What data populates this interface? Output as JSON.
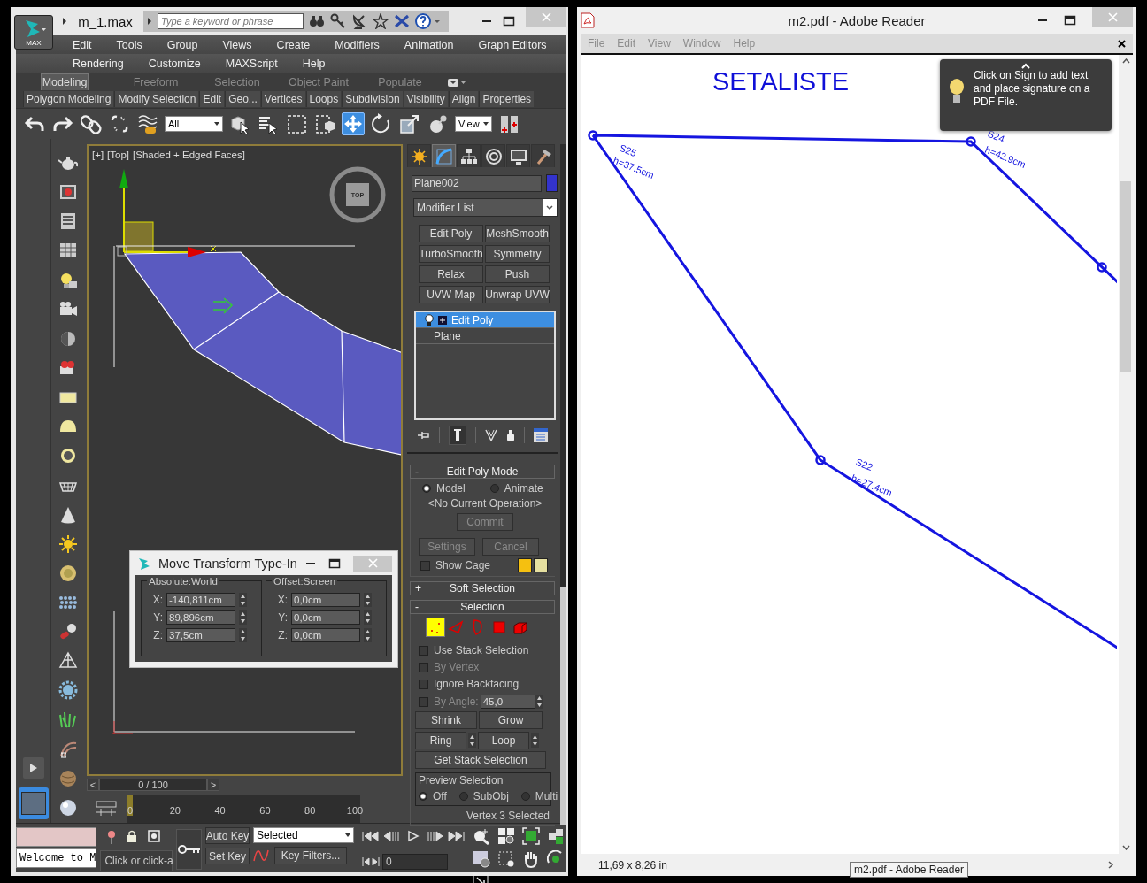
{
  "max_window": {
    "app_button": "MAX",
    "title": "m_1.max",
    "search": {
      "placeholder": "Type a keyword or phrase"
    },
    "menu_rows": [
      [
        "Edit",
        "Tools",
        "Group",
        "Views",
        "Create",
        "Modifiers",
        "Animation",
        "Graph Editors"
      ],
      [
        "Rendering",
        "Customize",
        "MAXScript",
        "Help"
      ]
    ],
    "ribbon_tabs": [
      {
        "label": "Modeling",
        "selected": true
      },
      {
        "label": "Freeform",
        "selected": false
      },
      {
        "label": "Selection",
        "selected": false
      },
      {
        "label": "Object Paint",
        "selected": false
      },
      {
        "label": "Populate",
        "selected": false
      }
    ],
    "ribbon_panels": [
      "Polygon Modeling",
      "Modify Selection",
      "Edit",
      "Geo...",
      "Vertices",
      "Loops",
      "Subdivision",
      "Visibility",
      "Align",
      "Properties"
    ],
    "toolbar": [
      {
        "kind": "undo",
        "selected": false
      },
      {
        "kind": "redo",
        "selected": false
      },
      {
        "kind": "link",
        "selected": false
      },
      {
        "kind": "unlink",
        "selected": false
      },
      {
        "kind": "bind",
        "selected": false
      },
      {
        "kind": "dropdown",
        "value": "All"
      },
      {
        "kind": "select",
        "selected": false
      },
      {
        "kind": "select_by_name",
        "selected": false
      },
      {
        "kind": "region",
        "selected": false
      },
      {
        "kind": "crossing",
        "selected": false
      },
      {
        "kind": "move",
        "selected": true
      },
      {
        "kind": "rotate",
        "selected": false
      },
      {
        "kind": "scale",
        "selected": false
      },
      {
        "kind": "place",
        "selected": false
      },
      {
        "kind": "dropdown",
        "value": "View"
      },
      {
        "kind": "pivot",
        "selected": false
      }
    ],
    "viewport": {
      "labels": [
        "[+]",
        "[Top]",
        "[Shaded + Edged Faces]"
      ],
      "viewcube": "TOP"
    },
    "type_in": {
      "title": "Move Transform Type-In",
      "groups": [
        {
          "title": "Absolute:World",
          "fields": [
            {
              "label": "X:",
              "value": "-140,811cm"
            },
            {
              "label": "Y:",
              "value": "89,896cm"
            },
            {
              "label": "Z:",
              "value": "37,5cm"
            }
          ]
        },
        {
          "title": "Offset:Screen",
          "fields": [
            {
              "label": "X:",
              "value": "0,0cm"
            },
            {
              "label": "Y:",
              "value": "0,0cm"
            },
            {
              "label": "Z:",
              "value": "0,0cm"
            }
          ]
        }
      ]
    },
    "command_panel": {
      "tabs": [
        {
          "kind": "create",
          "selected": false
        },
        {
          "kind": "modify",
          "selected": true
        },
        {
          "kind": "hierarchy",
          "selected": false
        },
        {
          "kind": "motion",
          "selected": false
        },
        {
          "kind": "display",
          "selected": false
        },
        {
          "kind": "utilities",
          "selected": false
        }
      ],
      "object_name": "Plane002",
      "modifier_list": "Modifier List",
      "modifier_buttons": [
        "Edit Poly",
        "MeshSmooth",
        "TurboSmooth",
        "Symmetry",
        "Relax",
        "Push",
        "UVW Map",
        "Unwrap UVW"
      ],
      "stack": [
        {
          "label": "Edit Poly",
          "selected": true
        },
        {
          "label": "Plane",
          "selected": false
        }
      ],
      "rollouts": [
        {
          "kind": "edit_poly_mode",
          "toggle": "-",
          "title": "Edit Poly Mode",
          "modes": [
            {
              "label": "Model",
              "selected": true
            },
            {
              "label": "Animate",
              "selected": false
            }
          ],
          "operation": "<No Current Operation>",
          "commit": "Commit",
          "settings": "Settings",
          "cancel": "Cancel",
          "show_cage": {
            "label": "Show Cage",
            "checked": false
          }
        },
        {
          "kind": "soft_selection",
          "toggle": "+",
          "title": "Soft Selection"
        },
        {
          "kind": "selection",
          "toggle": "-",
          "title": "Selection",
          "levels": [
            {
              "kind": "vertex",
              "selected": true
            },
            {
              "kind": "edge",
              "selected": false
            },
            {
              "kind": "border",
              "selected": false
            },
            {
              "kind": "polygon",
              "selected": false
            },
            {
              "kind": "element",
              "selected": false
            }
          ],
          "options": [
            {
              "label": "Use Stack Selection",
              "checked": false,
              "disabled": false
            },
            {
              "label": "By Vertex",
              "checked": false,
              "disabled": true
            },
            {
              "label": "Ignore Backfacing",
              "checked": false,
              "disabled": false
            },
            {
              "label": "By Angle:",
              "checked": false,
              "disabled": true,
              "value": "45,0"
            }
          ],
          "shrink": "Shrink",
          "grow": "Grow",
          "ring": "Ring",
          "loop": "Loop",
          "get_stack": "Get Stack Selection",
          "preview": {
            "title": "Preview Selection",
            "options": [
              {
                "label": "Off",
                "selected": true
              },
              {
                "label": "SubObj",
                "selected": false
              },
              {
                "label": "Multi",
                "selected": false
              }
            ]
          },
          "status": "Vertex 3 Selected"
        }
      ]
    },
    "timeline": {
      "prev": "<",
      "position": "0 / 100",
      "next": ">",
      "ticks": [
        "0",
        "20",
        "40",
        "60",
        "80",
        "100"
      ]
    },
    "status": {
      "prompt": "Welcome to M",
      "hint": "Click or click-a",
      "auto_key": "Auto Key",
      "set_key": "Set Key",
      "key_mode": "Selected",
      "key_filters": "Key Filters...",
      "frame": "0"
    }
  },
  "reader_window": {
    "title": "m2.pdf - Adobe Reader",
    "menu": [
      {
        "label": "File",
        "disabled": true
      },
      {
        "label": "Edit",
        "disabled": true
      },
      {
        "label": "View",
        "disabled": true
      },
      {
        "label": "Window",
        "disabled": true
      },
      {
        "label": "Help",
        "disabled": true
      }
    ],
    "document": {
      "heading": "SETALISTE",
      "points": [
        {
          "name": "S25",
          "height": "h=37.5cm"
        },
        {
          "name": "S24",
          "height": "h=42.9cm"
        },
        {
          "name": "S22",
          "height": "h=27.4cm"
        }
      ]
    },
    "tip": "Click on Sign to add text and place signature on a PDF File.",
    "page_size": "11,69 x 8,26 in"
  },
  "taskbar_tooltip": "m2.pdf - Adobe Reader"
}
